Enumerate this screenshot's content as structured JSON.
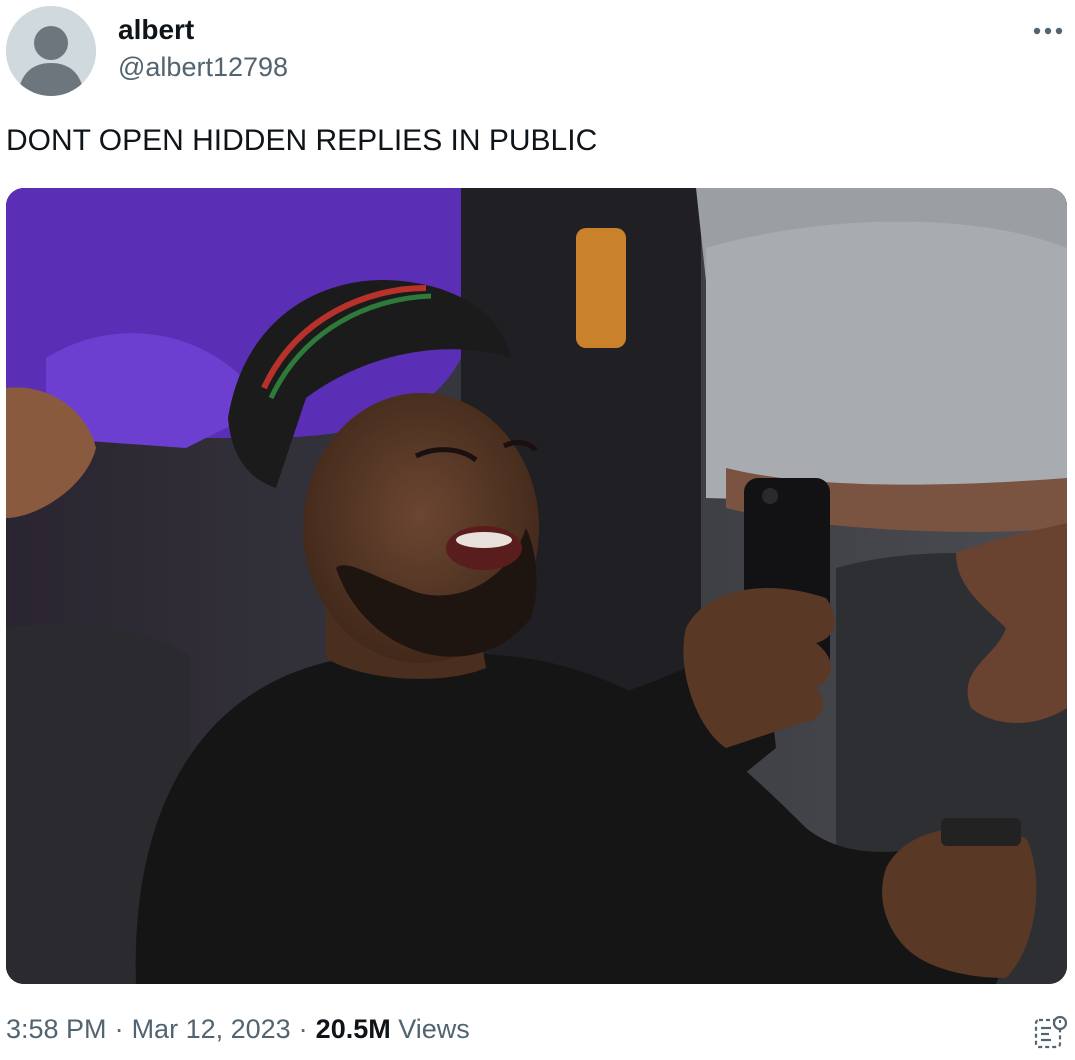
{
  "author": {
    "name": "albert",
    "handle": "@albert12798",
    "avatar_icon": "default-avatar-icon"
  },
  "tweet": {
    "text": "DONT OPEN HIDDEN REPLIES IN PUBLIC"
  },
  "meta": {
    "time": "3:58 PM",
    "separator": "·",
    "date": "Mar 12, 2023",
    "views_count": "20.5M",
    "views_label": "Views"
  },
  "icons": {
    "more": "more-dots-icon",
    "analytics": "analytics-icon"
  },
  "colors": {
    "text_primary": "#0f1419",
    "text_secondary": "#536471",
    "avatar_bg": "#cfd9de"
  }
}
